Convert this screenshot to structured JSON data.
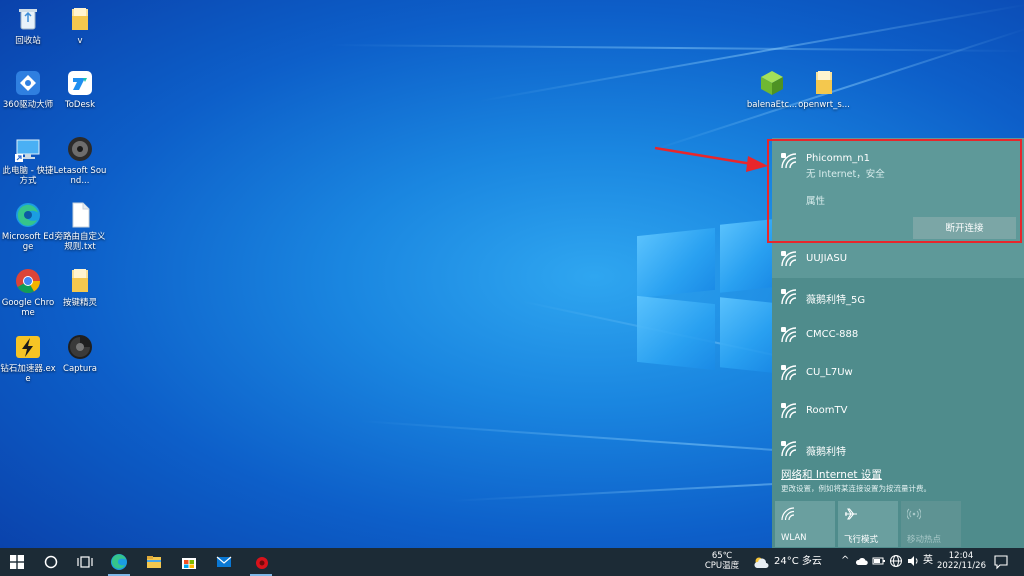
{
  "desktop": {
    "icons": [
      {
        "label": "回收站"
      },
      {
        "label": "v"
      },
      {
        "label": "360驱动大师"
      },
      {
        "label": "ToDesk"
      },
      {
        "label": "此电脑 - 快捷方式"
      },
      {
        "label": "Letasoft Sound..."
      },
      {
        "label": "Microsoft Edge"
      },
      {
        "label": "旁路由自定义规则.txt"
      },
      {
        "label": "Google Chrome"
      },
      {
        "label": "按键精灵"
      },
      {
        "label": "钻石加速器.exe"
      },
      {
        "label": "Captura"
      },
      {
        "label": "balenaEtc..."
      },
      {
        "label": "openwrt_s..."
      }
    ]
  },
  "wifi": {
    "connected": {
      "name": "Phicomm_n1",
      "status": "无 Internet，安全",
      "properties": "属性",
      "disconnect": "断开连接"
    },
    "networks": [
      {
        "name": "UUJIASU"
      },
      {
        "name": "薇鹅利特_5G"
      },
      {
        "name": "CMCC-888"
      },
      {
        "name": "CU_L7Uw"
      },
      {
        "name": "RoomTV"
      },
      {
        "name": "薇鹅利特"
      }
    ],
    "settings_link": "网络和 Internet 设置",
    "settings_desc": "更改设置，例如将某连接设置为按流量计费。",
    "quick_actions": [
      {
        "label": "WLAN",
        "icon": "wifi-icon"
      },
      {
        "label": "飞行模式",
        "icon": "airplane-icon"
      },
      {
        "label": "移动热点",
        "icon": "hotspot-icon"
      }
    ]
  },
  "taskbar": {
    "cpu_temp": "65℃",
    "cpu_label": "CPU温度",
    "weather": "24°C  多云",
    "ime": "英",
    "time": "12:04",
    "date": "2022/11/26"
  },
  "colors": {
    "flyout": "#4f8c8c",
    "highlight": "#e8262b",
    "taskbar": "#1c2b36"
  }
}
